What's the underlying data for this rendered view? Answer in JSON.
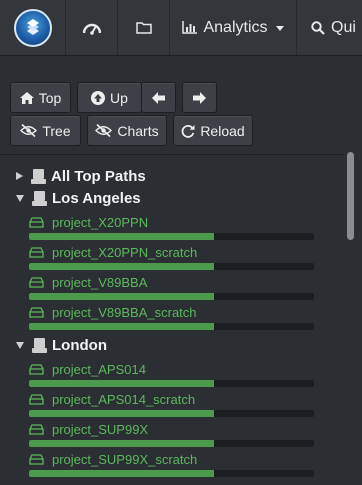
{
  "navbar": {
    "logo_icon": "app-logo-icon",
    "dashboard_icon": "speedometer-icon",
    "folder_icon": "folder-icon",
    "analytics_label": "Analytics",
    "analytics_icon": "bar-chart-icon",
    "quick_label": "Qui",
    "quick_icon": "search-icon"
  },
  "toolbar": {
    "top_label": "Top",
    "up_label": "Up",
    "tree_label": "Tree",
    "charts_label": "Charts",
    "reload_label": "Reload"
  },
  "tree": {
    "root_label": "All Top Paths",
    "groups": [
      {
        "label": "Los Angeles",
        "items": [
          {
            "label": "project_X20PPN",
            "usage": 0.65
          },
          {
            "label": "project_X20PPN_scratch",
            "usage": 0.65
          },
          {
            "label": "project_V89BBA",
            "usage": 0.65
          },
          {
            "label": "project_V89BBA_scratch",
            "usage": 0.65
          }
        ]
      },
      {
        "label": "London",
        "items": [
          {
            "label": "project_APS014",
            "usage": 0.65
          },
          {
            "label": "project_APS014_scratch",
            "usage": 0.65
          },
          {
            "label": "project_SUP99X",
            "usage": 0.65
          },
          {
            "label": "project_SUP99X_scratch",
            "usage": 0.65
          }
        ]
      }
    ]
  },
  "colors": {
    "usage_bar": "#4c9a4c",
    "item_text": "#5cb85c",
    "background": "#2b2e33"
  }
}
